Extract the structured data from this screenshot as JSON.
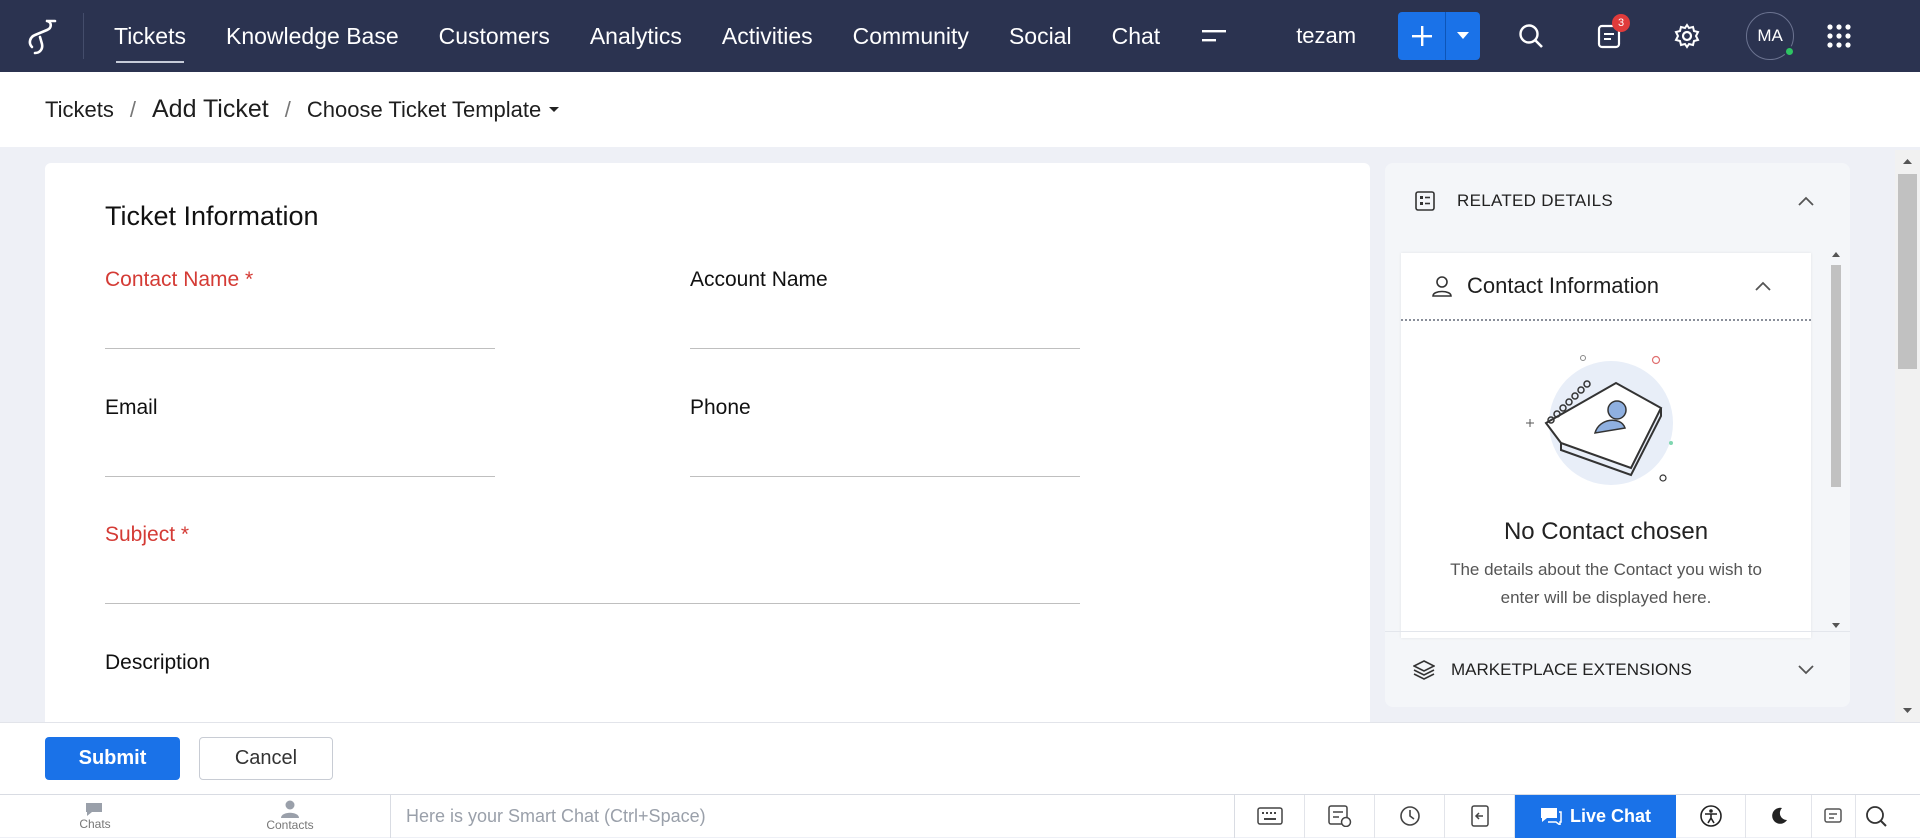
{
  "nav": {
    "items": [
      "Tickets",
      "Knowledge Base",
      "Customers",
      "Analytics",
      "Activities",
      "Community",
      "Social",
      "Chat"
    ],
    "active": "Tickets",
    "portal": "tezam",
    "notification_count": "3",
    "avatar_initials": "MA"
  },
  "breadcrumb": {
    "root": "Tickets",
    "current": "Add Ticket",
    "template": "Choose Ticket Template"
  },
  "form": {
    "title": "Ticket Information",
    "contact_name": "Contact Name *",
    "account_name": "Account Name",
    "email": "Email",
    "phone": "Phone",
    "subject": "Subject *",
    "description": "Description"
  },
  "side": {
    "related_details": "RELATED DETAILS",
    "contact_information": "Contact Information",
    "no_contact_title": "No Contact chosen",
    "no_contact_desc": "The details about the Contact you wish to enter will be displayed here.",
    "marketplace": "MARKETPLACE EXTENSIONS"
  },
  "actions": {
    "submit": "Submit",
    "cancel": "Cancel"
  },
  "bottombar": {
    "chats": "Chats",
    "contacts": "Contacts",
    "smart_chat_placeholder": "Here is your Smart Chat (Ctrl+Space)",
    "live_chat": "Live Chat"
  },
  "colors": {
    "topbar": "#2b3350",
    "accent": "#1a72e8",
    "required": "#d43b35"
  }
}
